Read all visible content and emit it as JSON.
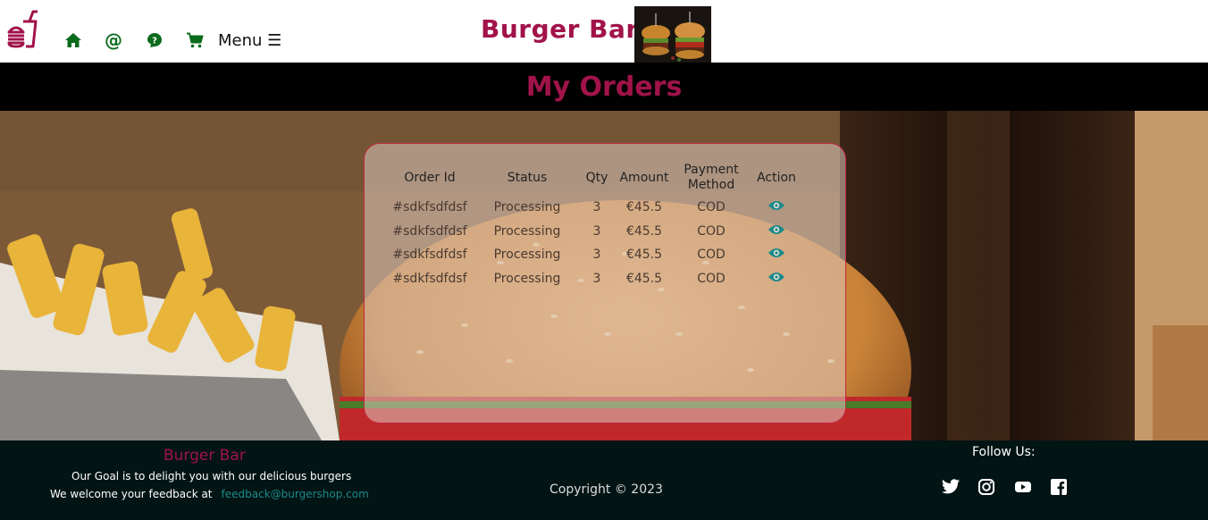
{
  "header": {
    "brand": "Burger Bar",
    "menu_label": "Menu ☰"
  },
  "page": {
    "title": "My Orders"
  },
  "orders": {
    "columns": [
      "Order Id",
      "Status",
      "Qty",
      "Amount",
      "Payment Method",
      "Action"
    ],
    "rows": [
      {
        "id": "#sdkfsdfdsf",
        "status": "Processing",
        "qty": "3",
        "amount": "€45.5",
        "payment": "COD"
      },
      {
        "id": "#sdkfsdfdsf",
        "status": "Processing",
        "qty": "3",
        "amount": "€45.5",
        "payment": "COD"
      },
      {
        "id": "#sdkfsdfdsf",
        "status": "Processing",
        "qty": "3",
        "amount": "€45.5",
        "payment": "COD"
      },
      {
        "id": "#sdkfsdfdsf",
        "status": "Processing",
        "qty": "3",
        "amount": "€45.5",
        "payment": "COD"
      }
    ]
  },
  "footer": {
    "brand": "Burger Bar",
    "goal": "Our Goal is to delight you with our delicious burgers",
    "feedback_text": "We welcome your feedback at",
    "feedback_email": "feedback@burgershop.com",
    "copyright": "Copyright © 2023",
    "follow_label": "Follow Us:"
  },
  "icons": {
    "logo": "fast-food-icon",
    "nav": [
      "home-icon",
      "at-icon",
      "help-icon",
      "cart-icon"
    ],
    "action": "eye-icon",
    "social": [
      "twitter-icon",
      "instagram-icon",
      "youtube-icon",
      "facebook-icon"
    ]
  },
  "colors": {
    "brand": "#a1134a",
    "nav_icon": "#0b6b1d",
    "eye": "#1b8a8a",
    "footer_bg": "#031414",
    "title_bar_bg": "#000000"
  }
}
